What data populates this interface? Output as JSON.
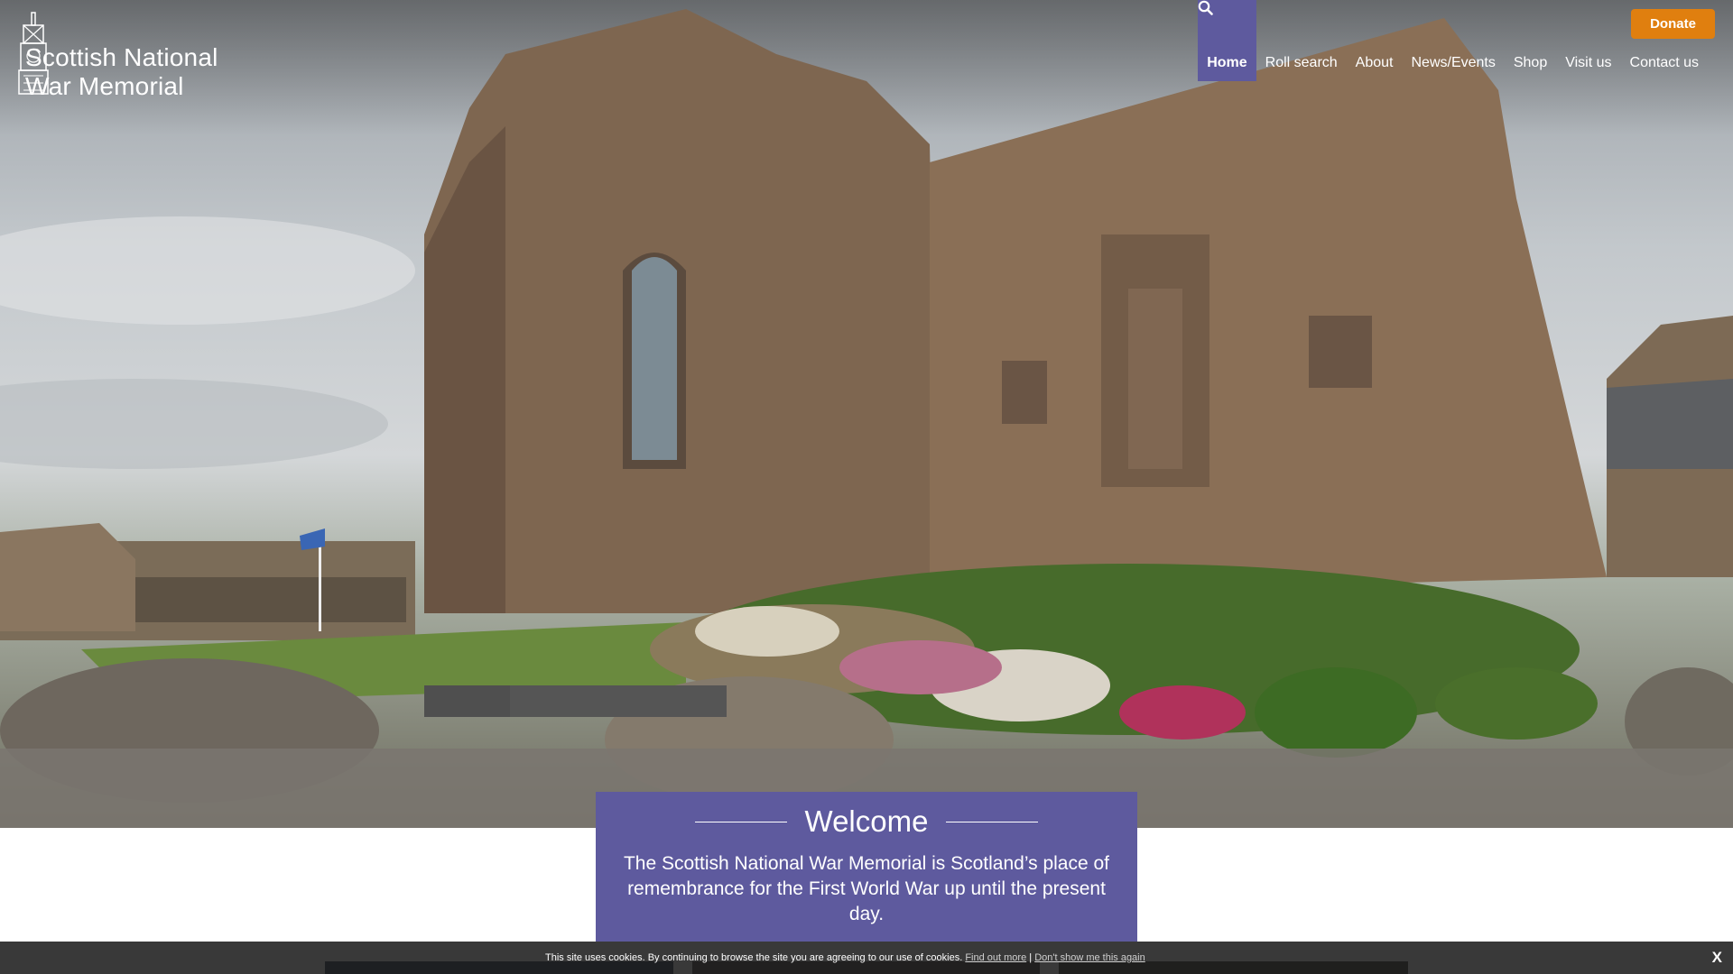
{
  "site": {
    "logo_line1": "Scottish National",
    "logo_line2": "War Memorial",
    "logo_icon": "memorial-crest-icon"
  },
  "header": {
    "donate_label": "Donate",
    "donate_color": "#e07f0f"
  },
  "nav": {
    "active_color": "#5e5a9e",
    "items": [
      {
        "label": "Home",
        "active": true
      },
      {
        "label": "Roll search"
      },
      {
        "label": "About"
      },
      {
        "label": "News/Events"
      },
      {
        "label": "Shop"
      },
      {
        "label": "Visit us"
      },
      {
        "label": "Contact us"
      }
    ],
    "search_icon": "search-icon"
  },
  "welcome": {
    "title": "Welcome",
    "text": "The Scottish National War Memorial is Scotland’s place of remembrance for the First World War up until the present day.",
    "background": "#5e5a9e"
  },
  "cookie": {
    "message": "This site uses cookies. By continuing to browse the site you are agreeing to our use of cookies.",
    "find_out_more": "Find out more",
    "separator": "|",
    "dont_show": "Don't show me this again",
    "close": "X"
  }
}
